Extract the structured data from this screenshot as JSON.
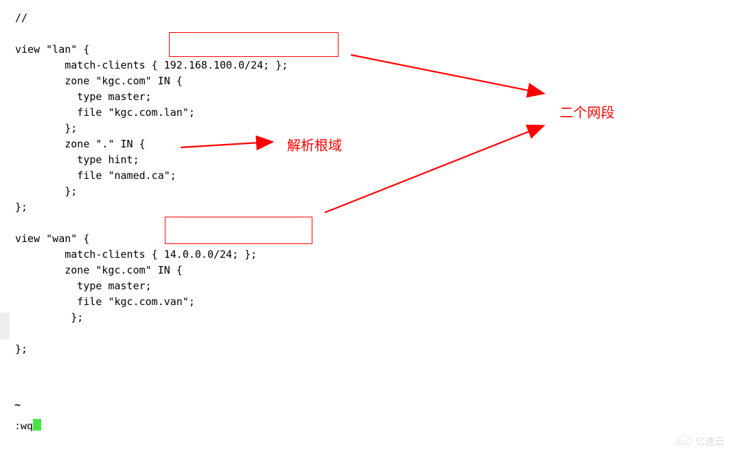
{
  "code": {
    "l0": "//",
    "l1": "",
    "l2": "view \"lan\" {",
    "l3": "        match-clients { 192.168.100.0/24; };",
    "l4": "        zone \"kgc.com\" IN {",
    "l5": "          type master;",
    "l6": "          file \"kgc.com.lan\";",
    "l7": "        };",
    "l8": "        zone \".\" IN {",
    "l9": "          type hint;",
    "l10": "          file \"named.ca\";",
    "l11": "        };",
    "l12": "};",
    "l13": "",
    "l14": "view \"wan\" {",
    "l15": "        match-clients { 14.0.0.0/24; };",
    "l16": "        zone \"kgc.com\" IN {",
    "l17": "          type master;",
    "l18": "          file \"kgc.com.van\";",
    "l19": "         };",
    "l20": "",
    "l21": "};"
  },
  "tilde": "~",
  "cmd": ":wq",
  "annotations": {
    "parse_root": "解析根域",
    "two_subnets": "二个网段"
  },
  "watermark": "亿速云"
}
